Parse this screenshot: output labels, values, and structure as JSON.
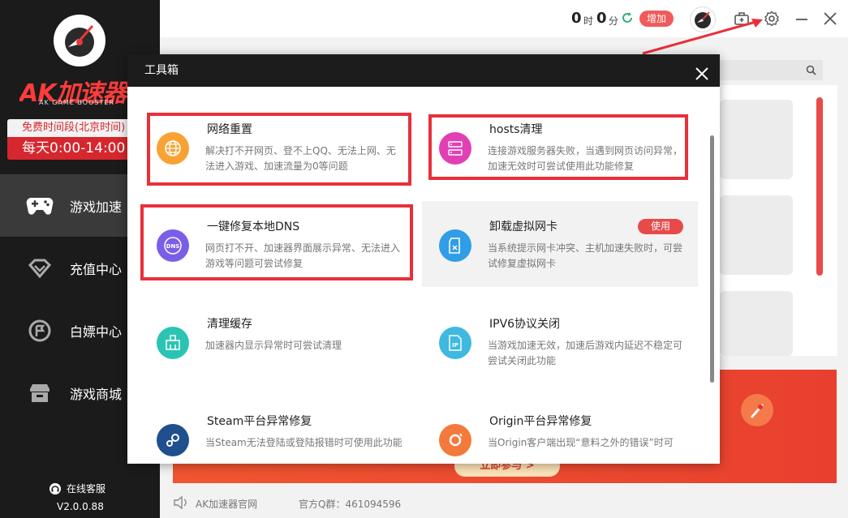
{
  "sidebar": {
    "brand": "AK加速器",
    "brand_sub": "AK GAME BOOSTER",
    "free_title": "免费时间段(北京时间)",
    "free_time": "每天0:00-14:00",
    "nav": [
      {
        "label": "游戏加速",
        "icon": "gamepad-icon",
        "active": true
      },
      {
        "label": "充值中心",
        "icon": "diamond-icon",
        "active": false
      },
      {
        "label": "白嫖中心",
        "icon": "flag-icon",
        "active": false
      },
      {
        "label": "游戏商城",
        "icon": "store-icon",
        "active": false
      }
    ],
    "customer_service": "在线客服",
    "version": "V2.0.0.88"
  },
  "topbar": {
    "hours": "0",
    "hour_unit": "时",
    "minutes": "0",
    "minute_unit": "分",
    "add_label": "增加"
  },
  "banner": {
    "button": "立即参与 >"
  },
  "footer": {
    "site": "AK加速器官网",
    "qq_group": "官方Q群：461094596"
  },
  "modal": {
    "title": "工具箱",
    "tools": [
      {
        "title": "网络重置",
        "desc": "解决打不开网页、登不上QQ、无法上网、无法进入游戏、加速流量为0等问题",
        "icon": "globe-icon",
        "color": "#f8a233"
      },
      {
        "title": "hosts清理",
        "desc": "连接游戏服务器失败，当遇到网页访问异常，加速无效时可尝试使用此功能修复",
        "icon": "server-icon",
        "color": "#e23fb5"
      },
      {
        "title": "一键修复本地DNS",
        "desc": "网页打不开、加速器界面展示异常、无法进入游戏等问题可尝试修复",
        "icon": "dns-icon",
        "color": "#7a5ee8"
      },
      {
        "title": "卸载虚拟网卡",
        "desc": "当系统提示网卡冲突、主机加速失败时，可尝试修复虚拟网卡",
        "icon": "sdcard-icon",
        "color": "#2f9ee6",
        "badge": "使用"
      },
      {
        "title": "清理缓存",
        "desc": "加速器内显示异常时可尝试清理",
        "icon": "broom-icon",
        "color": "#2bc4b4"
      },
      {
        "title": "IPV6协议关闭",
        "desc": "当游戏加速无效，加速后游戏内延迟不稳定可尝试关闭此功能",
        "icon": "ip-icon",
        "color": "#3fb9e0"
      },
      {
        "title": "Steam平台异常修复",
        "desc": "当Steam无法登陆或登陆报错时可使用此功能",
        "icon": "steam-icon",
        "color": "#1f4f8c"
      },
      {
        "title": "Origin平台异常修复",
        "desc": "当Origin客户端出现“意料之外的错误”时可",
        "icon": "origin-icon",
        "color": "#f47a3b"
      }
    ]
  }
}
